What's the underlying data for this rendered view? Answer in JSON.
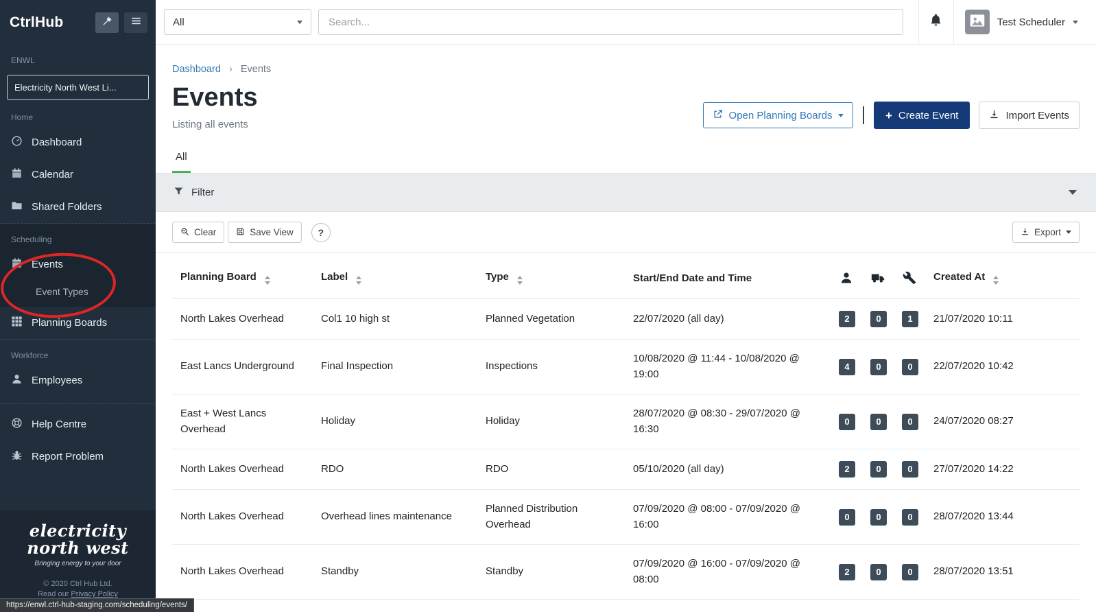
{
  "topbar": {
    "scope_select": "All",
    "search_placeholder": "Search...",
    "user": "Test Scheduler"
  },
  "sidebar": {
    "brand": "CtrlHub",
    "org_code": "ENWL",
    "org_name": "Electricity North West Li...",
    "section_home": "Home",
    "home_items": [
      {
        "label": "Dashboard"
      },
      {
        "label": "Calendar"
      },
      {
        "label": "Shared Folders"
      }
    ],
    "section_scheduling": "Scheduling",
    "scheduling_items": [
      {
        "label": "Events"
      },
      {
        "label": "Event Types"
      },
      {
        "label": "Planning Boards"
      }
    ],
    "section_workforce": "Workforce",
    "workforce_items": [
      {
        "label": "Employees"
      }
    ],
    "footer_items": [
      {
        "label": "Help Centre"
      },
      {
        "label": "Report Problem"
      }
    ],
    "logo_line1": "electricity",
    "logo_line2": "north west",
    "logo_tagline": "Bringing energy to your door",
    "copyright": "© 2020 Ctrl Hub Ltd.",
    "privacy_prefix": "Read our",
    "privacy_link": "Privacy Policy"
  },
  "page": {
    "breadcrumb_home": "Dashboard",
    "breadcrumb_sep": "›",
    "breadcrumb_current": "Events",
    "title": "Events",
    "subtitle": "Listing all events",
    "actions": {
      "open_planning_boards": "Open Planning Boards",
      "create_plus": "+",
      "create_event": "Create Event",
      "import_events": "Import Events"
    },
    "tab_all": "All",
    "filter_label": "Filter",
    "toolbar": {
      "clear": "Clear",
      "save_view": "Save View",
      "help": "?",
      "export": "Export"
    }
  },
  "table": {
    "headers": {
      "planning_board": "Planning Board",
      "label": "Label",
      "type": "Type",
      "datetime": "Start/End Date and Time",
      "created_at": "Created At"
    },
    "icon_columns": [
      "people-icon",
      "vehicle-icon",
      "equipment-icon"
    ],
    "rows": [
      {
        "planning_board": "North Lakes Overhead",
        "label": "Col1 10 high st",
        "type": "Planned Vegetation",
        "datetime": "22/07/2020 (all day)",
        "people": "2",
        "vehicles": "0",
        "equipment": "1",
        "created_at": "21/07/2020 10:11"
      },
      {
        "planning_board": "East Lancs Underground",
        "label": "Final Inspection",
        "type": "Inspections",
        "datetime": "10/08/2020 @ 11:44 - 10/08/2020 @ 19:00",
        "people": "4",
        "vehicles": "0",
        "equipment": "0",
        "created_at": "22/07/2020 10:42"
      },
      {
        "planning_board": "East + West Lancs Overhead",
        "label": "Holiday",
        "type": "Holiday",
        "datetime": "28/07/2020 @ 08:30 - 29/07/2020 @ 16:30",
        "people": "0",
        "vehicles": "0",
        "equipment": "0",
        "created_at": "24/07/2020 08:27"
      },
      {
        "planning_board": "North Lakes Overhead",
        "label": "RDO",
        "type": "RDO",
        "datetime": "05/10/2020 (all day)",
        "people": "2",
        "vehicles": "0",
        "equipment": "0",
        "created_at": "27/07/2020 14:22"
      },
      {
        "planning_board": "North Lakes Overhead",
        "label": "Overhead lines maintenance",
        "type": "Planned Distribution Overhead",
        "datetime": "07/09/2020 @ 08:00 - 07/09/2020 @ 16:00",
        "people": "0",
        "vehicles": "0",
        "equipment": "0",
        "created_at": "28/07/2020 13:44"
      },
      {
        "planning_board": "North Lakes Overhead",
        "label": "Standby",
        "type": "Standby",
        "datetime": "07/09/2020 @ 16:00 - 07/09/2020 @ 08:00",
        "people": "2",
        "vehicles": "0",
        "equipment": "0",
        "created_at": "28/07/2020 13:51"
      }
    ]
  },
  "browser": {
    "status_url": "https://enwl.ctrl-hub-staging.com/scheduling/events/"
  },
  "colors": {
    "sidebar_bg": "#232e3c",
    "accent_blue": "#337ab7",
    "create_button_navy": "#143a78",
    "tab_green": "#4caf50",
    "badge_bg": "#3e4b58",
    "filter_bar_bg": "#e9ecef",
    "annotation_red": "#de2626"
  }
}
